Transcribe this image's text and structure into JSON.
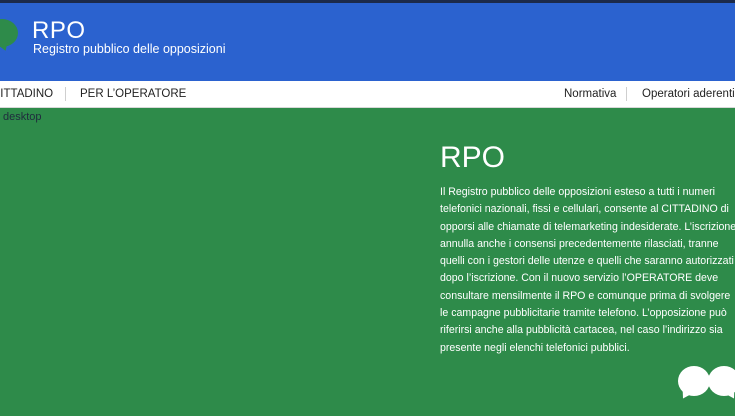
{
  "header": {
    "title": "RPO",
    "subtitle": "Registro pubblico delle opposizioni",
    "background_color": "#2b62cf",
    "logo_icon": "speech-bubble-icon"
  },
  "nav": {
    "left_items": [
      {
        "label": "CITTADINO"
      },
      {
        "label": "PER L’OPERATORE"
      }
    ],
    "right_items": [
      {
        "label": "Normativa"
      },
      {
        "label": "Operatori aderenti"
      }
    ]
  },
  "hero": {
    "image_alt": "desktop",
    "background_color": "#2e8b4a",
    "title": "RPO",
    "text": "Il Registro pubblico delle opposizioni esteso a tutti i numeri telefonici nazionali, fissi e cellulari, consente al CITTADINO di opporsi alle chiamate di telemarketing indesiderate. L’iscrizione annulla anche i consensi precedentemente rilasciati, tranne quelli con i gestori delle utenze e quelli che saranno autorizzati dopo l’iscrizione. Con il nuovo servizio l’OPERATORE deve consultare mensilmente il RPO e comunque prima di svolgere le campagne pubblicitarie tramite telefono. L’opposizione può riferirsi anche alla pubblicità cartacea, nel caso l’indirizzo sia presente negli elenchi telefonici pubblici.",
    "decor_icon": "speech-bubbles-icon"
  }
}
